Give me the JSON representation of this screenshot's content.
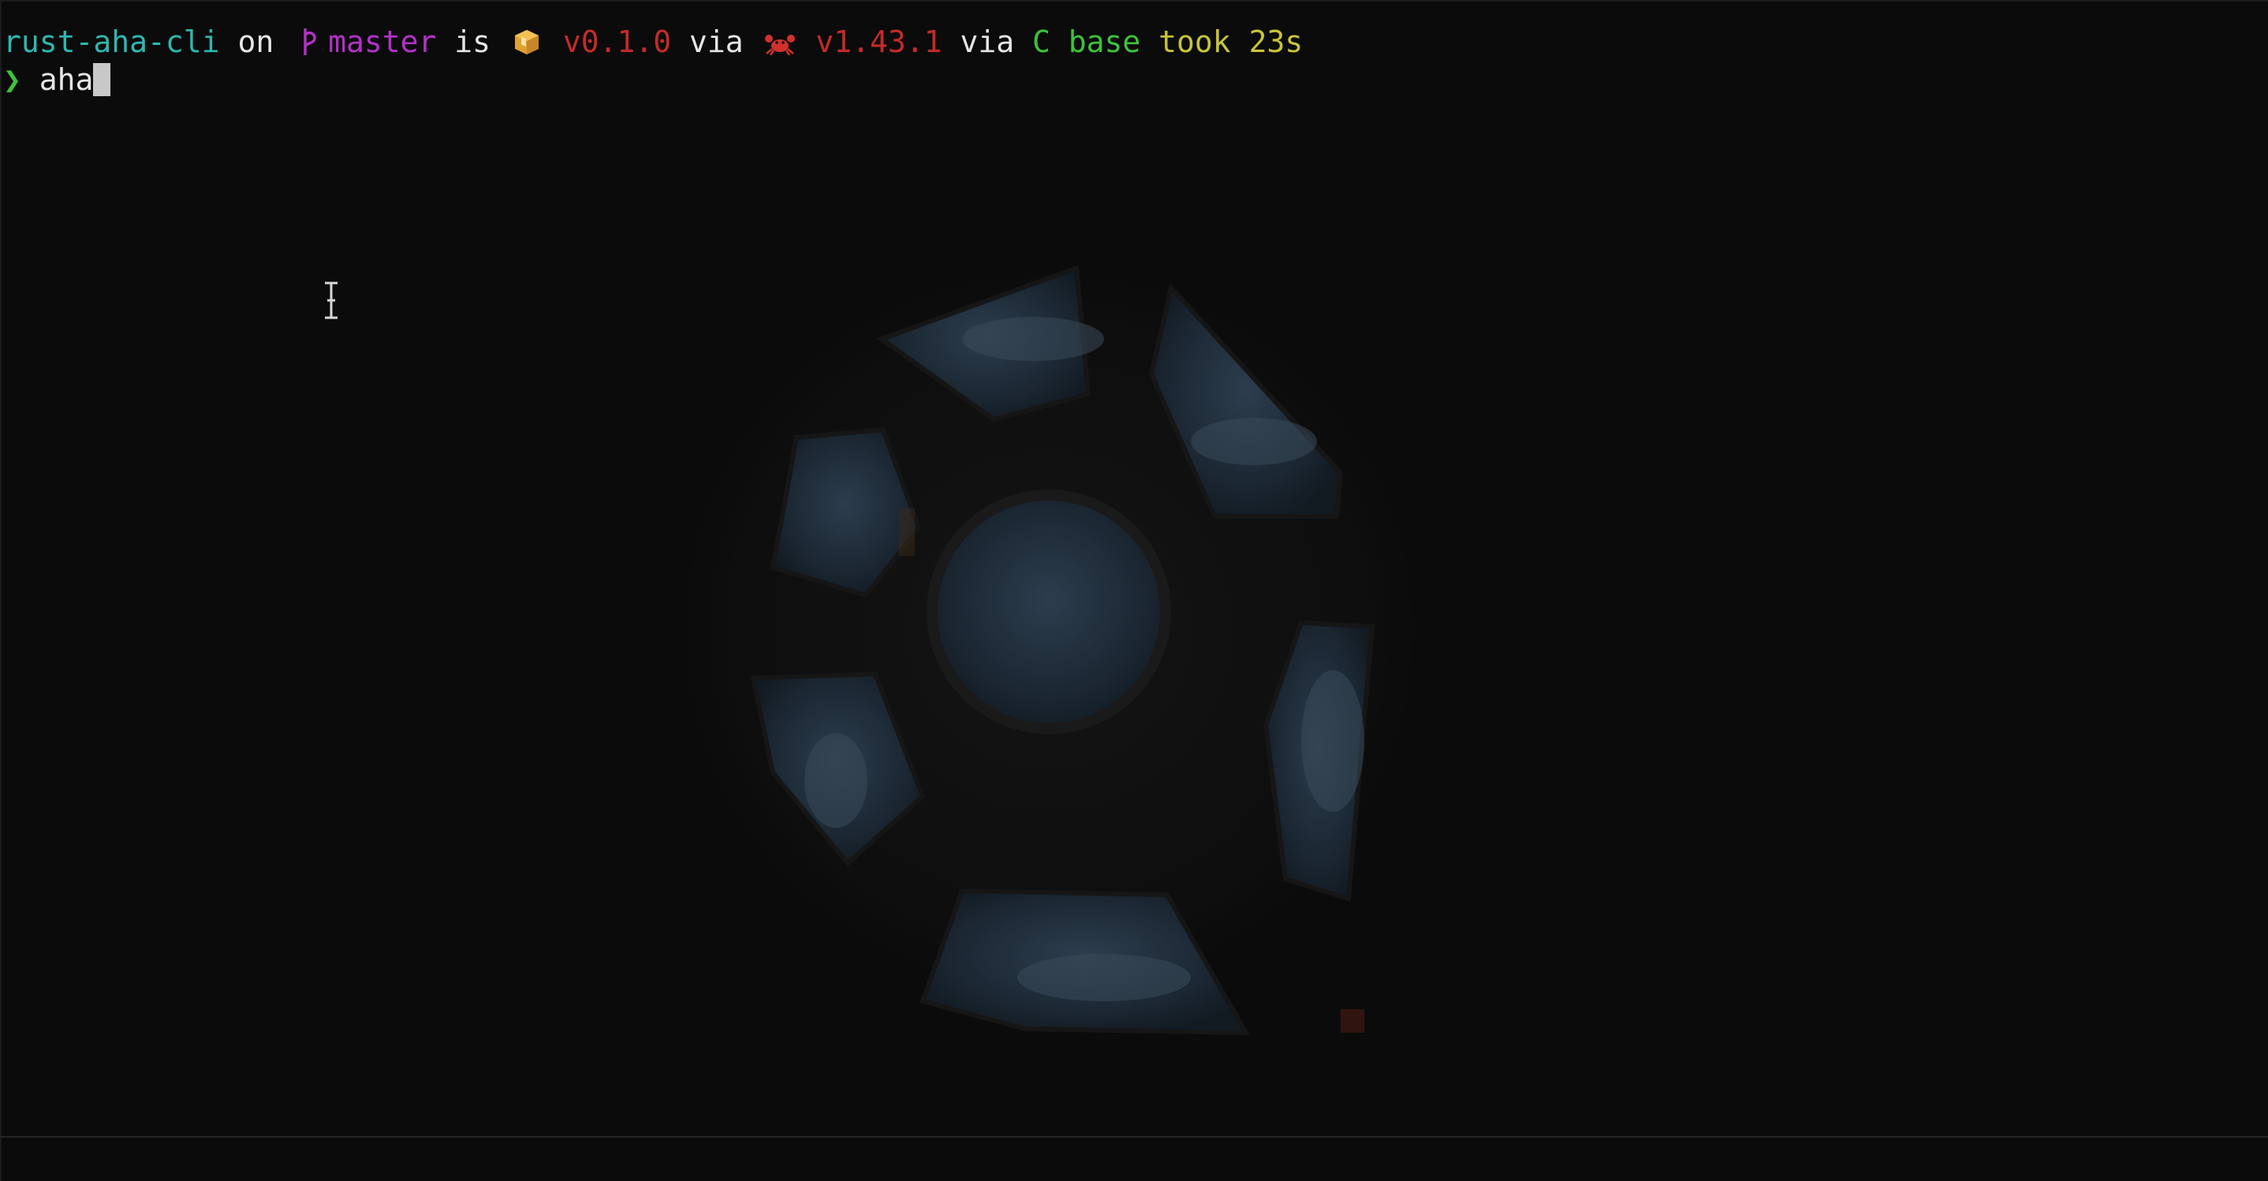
{
  "prompt": {
    "directory": "rust-aha-cli",
    "on": "on",
    "branch_icon": "git-branch-icon",
    "branch": "master",
    "is": "is",
    "package_icon": "package-icon",
    "package_version": "v0.1.0",
    "via1": "via",
    "rust_icon": "crab-icon",
    "rust_version": "v1.43.1",
    "via2": "via",
    "conda_env": "C base",
    "took": "took",
    "duration": "23s"
  },
  "command": {
    "prompt_char": "❯",
    "text": "aha"
  },
  "background": {
    "description_icon": "space-station-cupola-window"
  },
  "colors": {
    "directory": "#2fb7b0",
    "branch": "#b431c9",
    "version": "#c42a2a",
    "conda": "#3ec23e",
    "took": "#c7c43a",
    "background": "#0b0b0b"
  }
}
